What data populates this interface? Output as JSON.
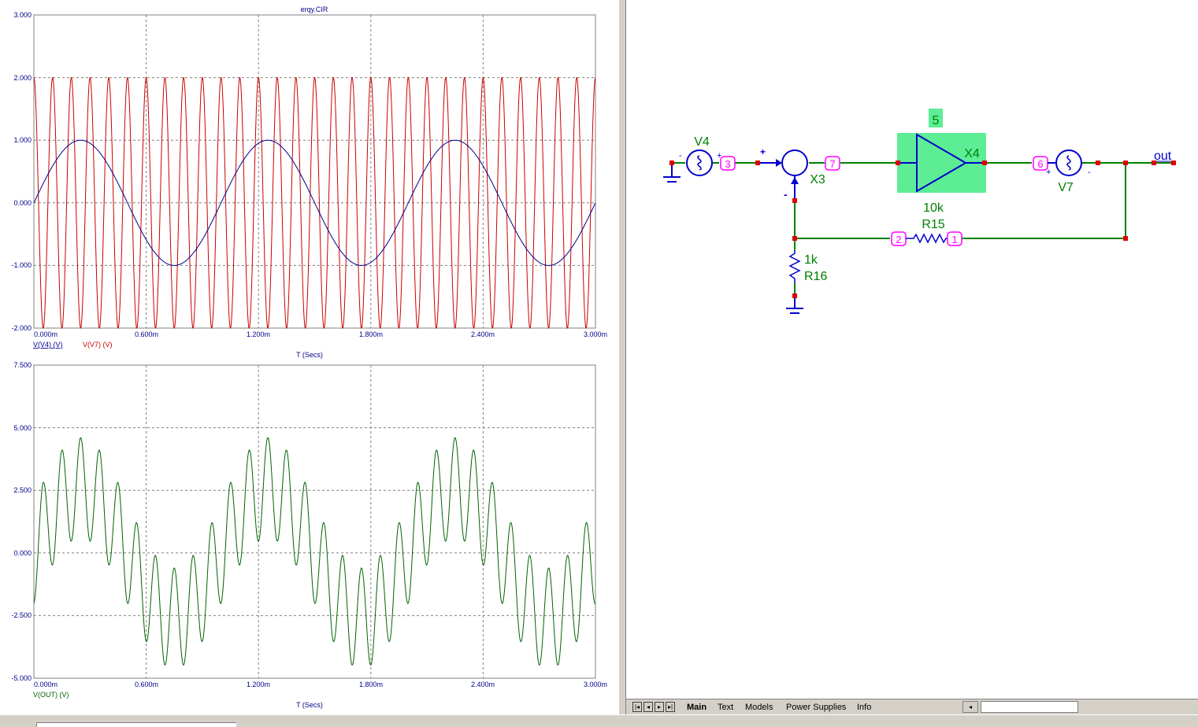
{
  "colors": {
    "v4_trace": "#00008b",
    "v7_trace": "#cc0000",
    "out_trace": "#006400",
    "wire": "#008000",
    "component": "#0000cc",
    "node_label": "#ff00ff",
    "pin": "#e00000",
    "highlight_fill": "#5ced95",
    "label_green": "#008000"
  },
  "top_plot": {
    "title": "erqy.CIR",
    "x_ticks": [
      "0.000m",
      "0.600m",
      "1.200m",
      "1.800m",
      "2.400m",
      "3.000m"
    ],
    "y_ticks": [
      "3.000",
      "2.000",
      "1.000",
      "0.000",
      "-1.000",
      "-2.000"
    ],
    "x_label": "T (Secs)",
    "legend": [
      "V(V4) (V)",
      "V(V7) (V)"
    ]
  },
  "bottom_plot": {
    "x_ticks": [
      "0.000m",
      "0.600m",
      "1.200m",
      "1.800m",
      "2.400m",
      "3.000m"
    ],
    "y_ticks": [
      "7.500",
      "5.000",
      "2.500",
      "0.000",
      "-2.500",
      "-5.000"
    ],
    "x_label": "T (Secs)",
    "legend": [
      "V(OUT) (V)"
    ]
  },
  "chart_data": [
    {
      "type": "line",
      "title": "erqy.CIR",
      "xlabel": "T (Secs)",
      "ylabel": "",
      "xlim": [
        0,
        3.0
      ],
      "ylim": [
        -2,
        3
      ],
      "grid": true,
      "x_unit": "ms",
      "series": [
        {
          "name": "V(V4) (V)",
          "function": "sine",
          "amplitude": 1.0,
          "frequency_hz": 1000,
          "phase_deg": 0
        },
        {
          "name": "V(V7) (V)",
          "function": "sine",
          "amplitude": 2.0,
          "frequency_hz": 10000,
          "phase_deg": 90
        }
      ]
    },
    {
      "type": "line",
      "xlabel": "T (Secs)",
      "ylabel": "",
      "xlim": [
        0,
        3.0
      ],
      "ylim": [
        -5,
        7.5
      ],
      "grid": true,
      "x_unit": "ms",
      "series": [
        {
          "name": "V(OUT) (V)",
          "function": "sum_of_sines",
          "components": [
            {
              "amplitude": 2.6,
              "frequency_hz": 1000,
              "phase_deg": 0
            },
            {
              "amplitude": 2.0,
              "frequency_hz": 10000,
              "phase_deg": -90
            }
          ]
        }
      ]
    }
  ],
  "schematic": {
    "components": {
      "v4_name": "V4",
      "x3_name": "X3",
      "x4_name": "X4",
      "x4_gain": "5",
      "v7_name": "V7",
      "r15_value": "10k",
      "r15_name": "R15",
      "r16_value": "1k",
      "r16_name": "R16",
      "out_label": "out"
    },
    "nodes": [
      "3",
      "7",
      "6",
      "2",
      "1"
    ],
    "signs": {
      "plus": "+",
      "minus": "-"
    }
  },
  "tabs": {
    "items": [
      "Main",
      "Text",
      "Models",
      "Power Supplies",
      "Info"
    ],
    "active": "Main"
  }
}
